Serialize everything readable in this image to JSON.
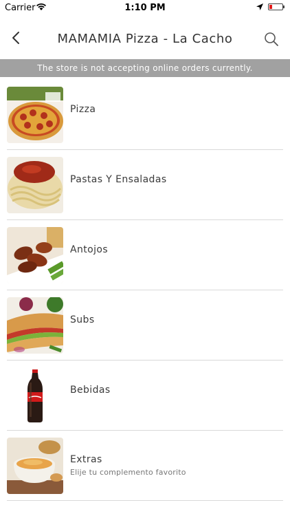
{
  "status_bar": {
    "carrier": "Carrier",
    "time": "1:10 PM"
  },
  "nav": {
    "title": "MAMAMIA Pizza - La Cacho"
  },
  "banner": {
    "text": "The store is not accepting online orders currently."
  },
  "categories": [
    {
      "label": "Pizza",
      "icon": "pizza-image"
    },
    {
      "label": "Pastas Y Ensaladas",
      "icon": "pasta-image"
    },
    {
      "label": "Antojos",
      "icon": "wings-image"
    },
    {
      "label": "Subs",
      "icon": "sub-sandwich-image"
    },
    {
      "label": "Bebidas",
      "icon": "soda-bottle-image"
    },
    {
      "label": "Extras",
      "sublabel": "Elije tu complemento favorito",
      "icon": "dip-bowl-image"
    }
  ],
  "colors": {
    "banner_bg": "#a1a1a1",
    "battery_low": "#e21b1b"
  }
}
